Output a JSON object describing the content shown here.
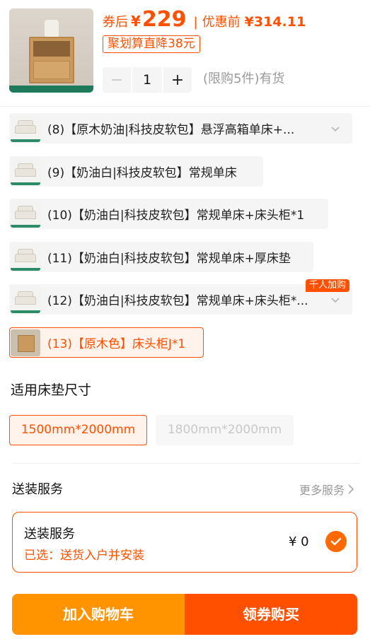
{
  "header": {
    "price_after_label": "券后",
    "currency": "¥",
    "price_after": "229",
    "separator": "|",
    "price_before_label": "优惠前",
    "price_before": "¥314.11",
    "promo_tag": "聚划算直降38元",
    "quantity": {
      "minus": "−",
      "value": "1",
      "plus": "+"
    },
    "limit_text": "(限购5件)有货"
  },
  "variants": [
    {
      "label": "(8)【原木奶油|科技皮软包】悬浮高箱单床+...",
      "thumb_icon": "bed-thumbnail",
      "has_dropdown": true
    },
    {
      "label": "(9)【奶油白|科技皮软包】常规单床",
      "thumb_icon": "bed-thumbnail",
      "has_dropdown": false
    },
    {
      "label": "(10)【奶油白|科技皮软包】常规单床+床头柜*1",
      "thumb_icon": "bed-thumbnail",
      "has_dropdown": false
    },
    {
      "label": "(11)【奶油白|科技皮软包】常规单床+厚床垫",
      "thumb_icon": "bed-thumbnail",
      "has_dropdown": false
    },
    {
      "label": "(12)【奶油白|科技皮软包】常规单床+床头柜*...",
      "thumb_icon": "bed-thumbnail",
      "has_dropdown": true,
      "badge": "千人加购"
    },
    {
      "label": "(13)【原木色】床头柜J*1",
      "thumb_icon": "nightstand-thumbnail",
      "has_dropdown": false,
      "selected": true
    }
  ],
  "size": {
    "title": "适用床垫尺寸",
    "options": [
      {
        "label": "1500mm*2000mm",
        "state": "selected"
      },
      {
        "label": "1800mm*2000mm",
        "state": "disabled"
      }
    ]
  },
  "service": {
    "title": "送装服务",
    "more_label": "更多服务",
    "card": {
      "title": "送装服务",
      "selected_text": "已选：送货入户并安装",
      "price": "¥ 0",
      "checked": true
    }
  },
  "actions": {
    "add_to_cart": "加入购物车",
    "buy_with_coupon": "领券购买"
  },
  "colors": {
    "accent": "#ff5000",
    "cart_button": "#ff9400",
    "selected_bg": "#fff3ec",
    "chip_bg": "#f5f5f5"
  }
}
